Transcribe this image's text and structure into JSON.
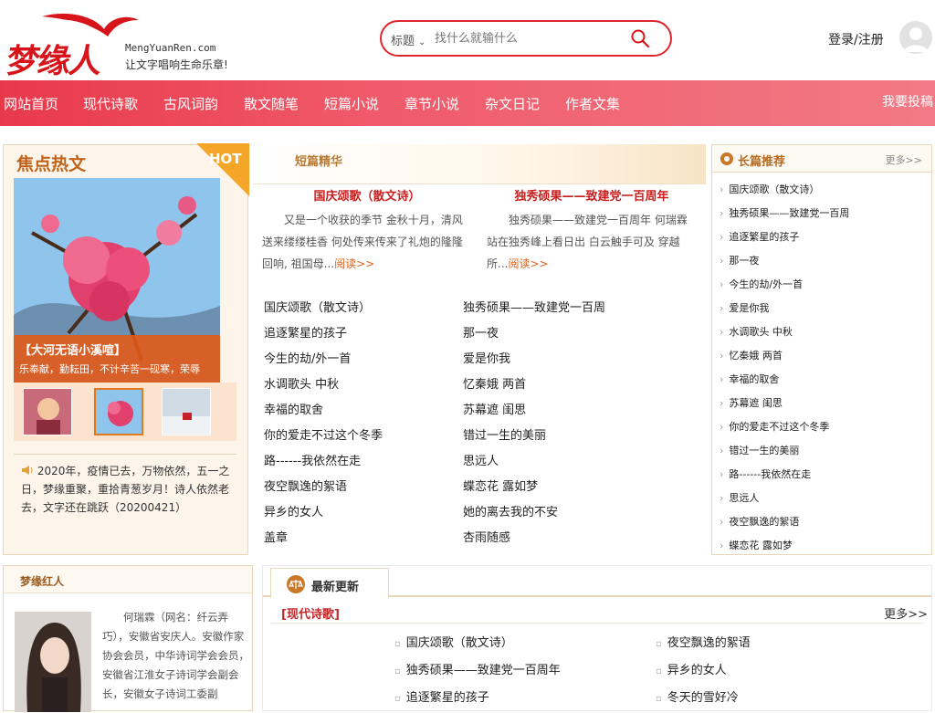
{
  "header": {
    "logo_cn": "梦缘人",
    "logo_en": "MengYuanRen.com",
    "slogan": "让文字唱响生命乐章!",
    "search_select": "标题",
    "search_placeholder": "找什么就输什么",
    "login_text": "登录/注册"
  },
  "nav": {
    "items": [
      "网站首页",
      "现代诗歌",
      "古风词韵",
      "散文随笔",
      "短篇小说",
      "章节小说",
      "杂文日记",
      "作者文集"
    ],
    "post_label": "我要投稿"
  },
  "hot": {
    "title": "焦点热文",
    "badge": "HOT",
    "caption_title": "【大河无语小溪喧】",
    "caption_sub": "乐奉献，勤耘田，不计辛苦一砚寒，荣辱",
    "announce": "2020年，疫情已去，万物依然，五一之日，梦缘重聚，重拾青葱岁月！诗人依然老去，文字还在跳跃（20200421）"
  },
  "short": {
    "title": "短篇精华",
    "feature1_title": "国庆颂歌（散文诗）",
    "feature1_body": "又是一个收获的季节 金秋十月，清风送来缕缕桂香 何处传来传来了礼炮的隆隆回响, 祖国母...",
    "feature2_title": "独秀硕果——致建党一百周年",
    "feature2_body": "独秀硕果——致建党一百周年 何瑞霖 站在独秀峰上看日出 白云触手可及 穿越所...",
    "read_more": "阅读>>",
    "col1": [
      "国庆颂歌（散文诗）",
      "追逐繁星的孩子",
      "今生的劫/外一首",
      "水调歌头 中秋",
      "幸福的取舍",
      "你的爱走不过这个冬季",
      "路------我依然在走",
      "夜空飘逸的絮语",
      "异乡的女人",
      "盖章"
    ],
    "col2": [
      "独秀硕果——致建党一百周",
      "那一夜",
      "爱是你我",
      "忆秦娥 两首",
      "苏幕遮 闺思",
      "错过一生的美丽",
      "思远人",
      "蝶恋花 露如梦",
      "她的离去我的不安",
      "杏雨随感"
    ]
  },
  "long": {
    "title": "长篇推荐",
    "more": "更多>>",
    "items": [
      "国庆颂歌（散文诗）",
      "独秀硕果——致建党一百周",
      "追逐繁星的孩子",
      "那一夜",
      "今生的劫/外一首",
      "爱是你我",
      "水调歌头 中秋",
      "忆秦娥 两首",
      "幸福的取舍",
      "苏幕遮 闺思",
      "你的爱走不过这个冬季",
      "错过一生的美丽",
      "路------我依然在走",
      "思远人",
      "夜空飘逸的絮语",
      "蝶恋花 露如梦"
    ]
  },
  "red": {
    "title": "梦缘红人",
    "bio": "何瑞霖（网名：纤云弄巧），安徽省安庆人。安徽作家协会会员，中华诗词学会会员，安徽省江淮女子诗词学会副会长，安徽女子诗词工委副"
  },
  "latest": {
    "title": "最新更新",
    "category": "[现代诗歌]",
    "more": "更多>>",
    "col1": [
      "国庆颂歌（散文诗）",
      "独秀硕果——致建党一百周年",
      "追逐繁星的孩子"
    ],
    "col2": [
      "夜空飘逸的絮语",
      "异乡的女人",
      "冬天的雪好冷"
    ]
  },
  "colors": {
    "accent": "#e8394b",
    "brand_red": "#d8141b",
    "orange": "#e0601a"
  }
}
